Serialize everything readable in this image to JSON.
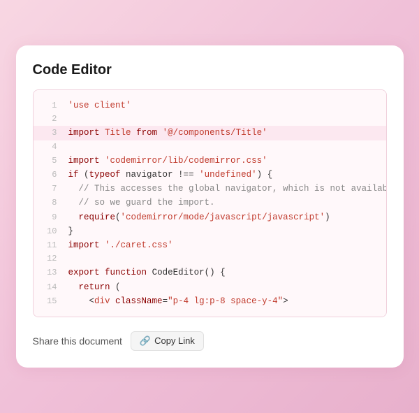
{
  "card": {
    "title": "Code Editor"
  },
  "code": {
    "lines": [
      {
        "num": 1,
        "text": "'use client'",
        "type": "str"
      },
      {
        "num": 2,
        "text": "",
        "type": "empty"
      },
      {
        "num": 3,
        "text": "import Title from '@/components/Title'",
        "type": "import-title",
        "highlight": true
      },
      {
        "num": 4,
        "text": "",
        "type": "empty"
      },
      {
        "num": 5,
        "text": "import 'codemirror/lib/codemirror.css'",
        "type": "import-str"
      },
      {
        "num": 6,
        "text": "if (typeof navigator !== 'undefined') {",
        "type": "if"
      },
      {
        "num": 7,
        "text": "  // This accesses the global navigator, which is not available in SSR,",
        "type": "comment"
      },
      {
        "num": 8,
        "text": "  // so we guard the import.",
        "type": "comment"
      },
      {
        "num": 9,
        "text": "  require('codemirror/mode/javascript/javascript')",
        "type": "require"
      },
      {
        "num": 10,
        "text": "}",
        "type": "brace"
      },
      {
        "num": 11,
        "text": "import './caret.css'",
        "type": "import-str2"
      },
      {
        "num": 12,
        "text": "",
        "type": "empty"
      },
      {
        "num": 13,
        "text": "export function CodeEditor() {",
        "type": "fn"
      },
      {
        "num": 14,
        "text": "  return (",
        "type": "return"
      },
      {
        "num": 15,
        "text": "    <div className=\"p-4 lg:p-8 space-y-4\">",
        "type": "jsx"
      }
    ]
  },
  "share": {
    "label": "Share this document",
    "copy_link_label": "Copy Link",
    "link_icon": "🔗"
  }
}
